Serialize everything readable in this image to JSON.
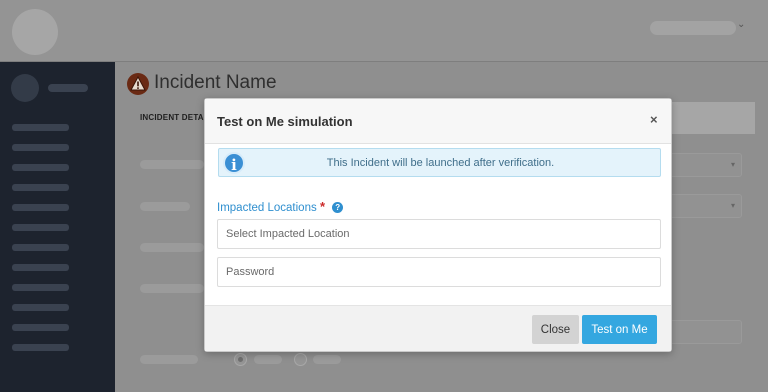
{
  "page": {
    "title": "Incident Name",
    "tab_label": "INCIDENT DETA"
  },
  "modal": {
    "title": "Test on Me simulation",
    "close_glyph": "×",
    "alert": {
      "icon": "i",
      "text": "This Incident will be launched after verification."
    },
    "impacted_locations": {
      "label": "Impacted Locations",
      "required_mark": "*",
      "help_glyph": "?",
      "placeholder": "Select Impacted Location"
    },
    "password": {
      "placeholder": "Password"
    },
    "buttons": {
      "close": "Close",
      "submit": "Test on Me"
    }
  },
  "icons": {
    "title": "warning-triangle-icon",
    "alert": "info-icon",
    "help": "help-icon",
    "close": "close-icon",
    "user_menu": "chevron-down-icon"
  },
  "colors": {
    "primary": "#34a7e0",
    "label": "#2f8fcf",
    "required": "#cc2a2a",
    "alert_bg": "#e4f3fb",
    "sidebar": "#1d232e"
  }
}
